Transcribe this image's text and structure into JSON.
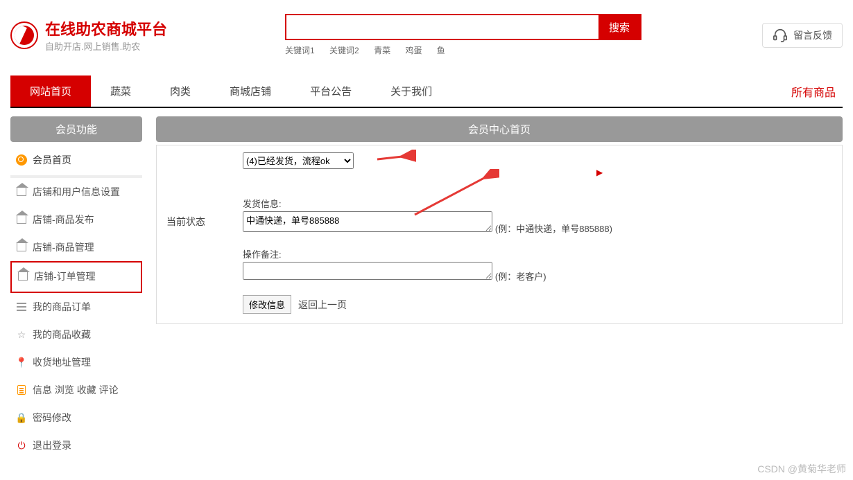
{
  "header": {
    "main_title": "在线助农商城平台",
    "sub_title": "自助开店.网上销售.助农",
    "search_placeholder": "",
    "search_btn": "搜索",
    "keywords": [
      "关键词1",
      "关键词2",
      "青菜",
      "鸡蛋",
      "鱼"
    ],
    "feedback": "留言反馈"
  },
  "nav": {
    "items": [
      "网站首页",
      "蔬菜",
      "肉类",
      "商城店铺",
      "平台公告",
      "关于我们"
    ],
    "right": "所有商品"
  },
  "sidebar": {
    "title": "会员功能",
    "items": [
      "会员首页",
      "店铺和用户信息设置",
      "店铺-商品发布",
      "店铺-商品管理",
      "店铺-订单管理",
      "我的商品订单",
      "我的商品收藏",
      "收货地址管理",
      "信息 浏览 收藏 评论",
      "密码修改",
      "退出登录"
    ]
  },
  "panel": {
    "title": "会员中心首页",
    "row_label": "当前状态",
    "status_select": "(4)已经发货，流程ok",
    "ship_label": "发货信息:",
    "ship_value": "中通快递，单号885888",
    "ship_hint": "(例：中通快递，单号885888)",
    "note_label": "操作备注:",
    "note_value": "",
    "note_hint": "(例：老客户)",
    "submit": "修改信息",
    "back": "返回上一页"
  },
  "watermark": "CSDN @黄菊华老师"
}
